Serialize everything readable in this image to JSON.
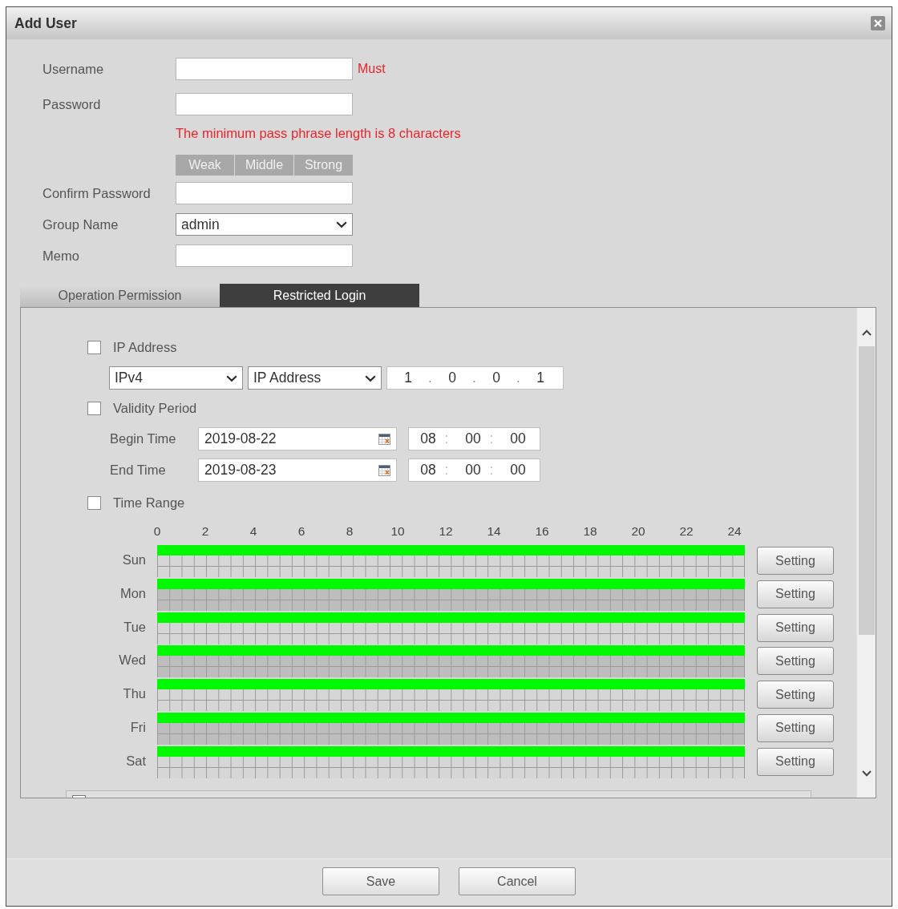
{
  "window": {
    "title": "Add User"
  },
  "form": {
    "rows": [
      {
        "kind": "input",
        "label": "Username",
        "note": "Must"
      },
      {
        "kind": "input",
        "label": "Password"
      },
      {
        "kind": "hint",
        "text": "The minimum pass phrase length is 8 characters"
      },
      {
        "kind": "strength",
        "segments": [
          "Weak",
          "Middle",
          "Strong"
        ]
      },
      {
        "kind": "input",
        "label": "Confirm Password"
      },
      {
        "kind": "select",
        "label": "Group Name",
        "value": "admin"
      },
      {
        "kind": "input",
        "label": "Memo"
      }
    ]
  },
  "tabs": [
    {
      "label": "Operation Permission",
      "selected": false
    },
    {
      "label": "Restricted Login",
      "selected": true
    }
  ],
  "restricted_login": {
    "ip_address": {
      "label": "IP Address",
      "checked": false,
      "version": "IPv4",
      "mode": "IP Address",
      "octets": [
        "1",
        "0",
        "0",
        "1"
      ],
      "separator": "."
    },
    "validity_period": {
      "label": "Validity Period",
      "checked": false,
      "separator": ":",
      "times": [
        {
          "label": "Begin Time",
          "date": "2019-08-22",
          "time": [
            "08",
            "00",
            "00"
          ]
        },
        {
          "label": "End Time",
          "date": "2019-08-23",
          "time": [
            "08",
            "00",
            "00"
          ]
        }
      ]
    },
    "time_range": {
      "label": "Time Range",
      "checked": false,
      "hours": [
        "0",
        "2",
        "4",
        "6",
        "8",
        "10",
        "12",
        "14",
        "16",
        "18",
        "20",
        "22",
        "24"
      ],
      "days": [
        {
          "day": "Sun",
          "level": 1,
          "button": "Setting"
        },
        {
          "day": "Mon",
          "level": 1,
          "button": "Setting"
        },
        {
          "day": "Tue",
          "level": 1,
          "button": "Setting"
        },
        {
          "day": "Wed",
          "level": 1,
          "button": "Setting"
        },
        {
          "day": "Thu",
          "level": 1,
          "button": "Setting"
        },
        {
          "day": "Fri",
          "level": 1,
          "button": "Setting"
        },
        {
          "day": "Sat",
          "level": 1,
          "button": "Setting"
        }
      ]
    },
    "partial_option": {
      "checked": false
    }
  },
  "footer": {
    "buttons": [
      "Save",
      "Cancel"
    ]
  }
}
